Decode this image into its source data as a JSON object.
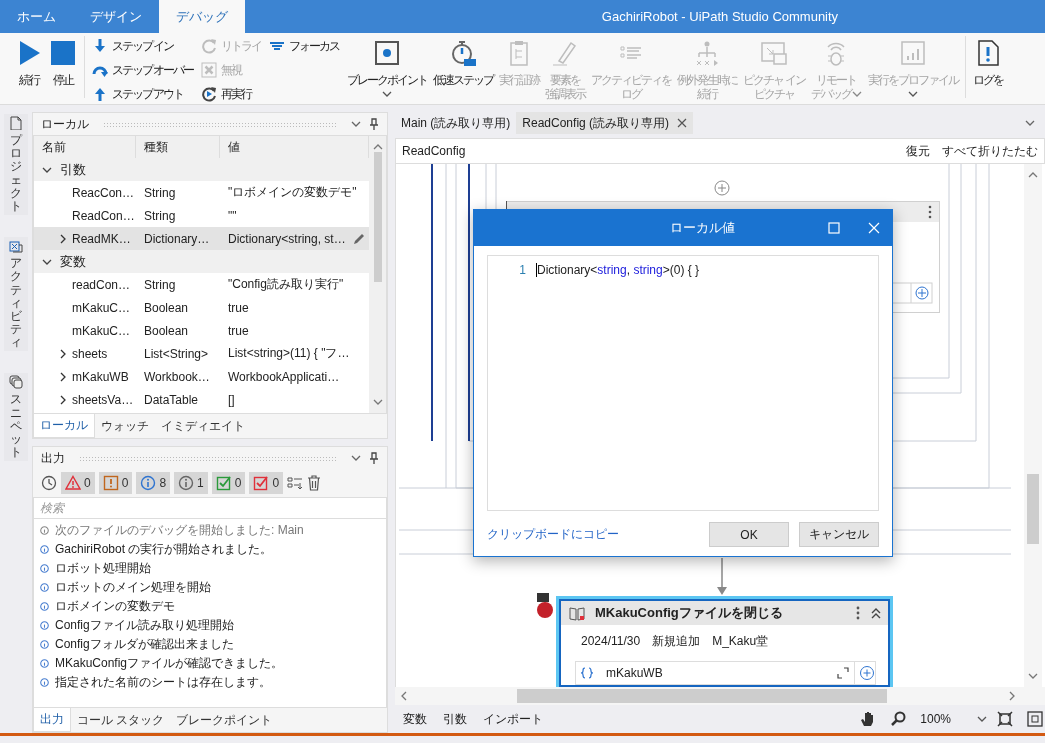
{
  "title_bar": {
    "tabs": [
      {
        "label": "ホーム",
        "selected": false
      },
      {
        "label": "デザイン",
        "selected": false
      },
      {
        "label": "デバッグ",
        "selected": true
      }
    ],
    "title": "GachiriRobot - UiPath Studio Community"
  },
  "ribbon": {
    "sections": [
      {
        "buttons": [
          {
            "kind": "large",
            "lines": [
              "続行"
            ],
            "disabled": false
          },
          {
            "kind": "large",
            "lines": [
              "停止"
            ],
            "disabled": false
          }
        ]
      },
      {
        "buttons": [
          {
            "kind": "small",
            "label": "ステップ イン",
            "disabled": false
          },
          {
            "kind": "small",
            "label": "ステップ オーバー",
            "disabled": false
          },
          {
            "kind": "small",
            "label": "ステップ アウト",
            "disabled": false
          },
          {
            "kind": "small",
            "label": "リトライ",
            "disabled": true
          },
          {
            "kind": "small",
            "label": "無視",
            "disabled": true
          },
          {
            "kind": "small",
            "label": "再実行",
            "disabled": false
          },
          {
            "kind": "small",
            "label": "フォーカス",
            "disabled": false
          },
          {
            "kind": "large",
            "lines": [
              "ブレークポイント"
            ],
            "disabled": false,
            "dropdown": true
          },
          {
            "kind": "large",
            "lines": [
              "低速ステップ"
            ],
            "disabled": false
          },
          {
            "kind": "large",
            "lines": [
              "実行証跡"
            ],
            "disabled": true
          },
          {
            "kind": "large",
            "lines": [
              "要素を",
              "強調表示"
            ],
            "disabled": true
          },
          {
            "kind": "large",
            "lines": [
              "アクティビティを",
              "ログ"
            ],
            "disabled": true
          },
          {
            "kind": "large",
            "lines": [
              "例外発生時に",
              "続行"
            ],
            "disabled": true
          },
          {
            "kind": "large",
            "lines": [
              "ピクチャ イン",
              "ピクチャ"
            ],
            "disabled": true
          },
          {
            "kind": "large",
            "lines": [
              "リモート",
              "デバッグ"
            ],
            "disabled": true,
            "dropdown": true
          },
          {
            "kind": "large",
            "lines": [
              "実行をプロファイル"
            ],
            "disabled": true,
            "dropdown": true
          }
        ]
      },
      {
        "buttons": [
          {
            "kind": "large",
            "lines": [
              "ログを"
            ],
            "disabled": false
          }
        ]
      }
    ]
  },
  "side_tabs": [
    {
      "label": "プロジェクト",
      "selected": false
    },
    {
      "label": "アクティビティ",
      "selected": false
    },
    {
      "label": "スニペット",
      "selected": false
    }
  ],
  "locals": {
    "title": "ローカル",
    "columns": [
      "名前",
      "種類",
      "値"
    ],
    "groups": [
      {
        "label": "引数",
        "expanded": true,
        "rows": [
          {
            "name": "ReacCon…",
            "type": "String",
            "value": "\"ロボメインの変数デモ\"",
            "expandable": false,
            "selected": false
          },
          {
            "name": "ReadCon…",
            "type": "String",
            "value": "\"\"",
            "expandable": false,
            "selected": false
          },
          {
            "name": "ReadMK…",
            "type": "Dictionary…",
            "value": "Dictionary<string, st…",
            "expandable": true,
            "selected": true
          }
        ]
      },
      {
        "label": "変数",
        "expanded": true,
        "rows": [
          {
            "name": "readCon…",
            "type": "String",
            "value": "\"Config読み取り実行\"",
            "expandable": false,
            "selected": false
          },
          {
            "name": "mKakuC…",
            "type": "Boolean",
            "value": "true",
            "expandable": false,
            "selected": false
          },
          {
            "name": "mKakuC…",
            "type": "Boolean",
            "value": "true",
            "expandable": false,
            "selected": false
          },
          {
            "name": "sheets",
            "type": "List<String>",
            "value": "List<string>(11) { \"フ…",
            "expandable": true,
            "selected": false
          },
          {
            "name": "mKakuWB",
            "type": "Workbook…",
            "value": "WorkbookApplicati…",
            "expandable": true,
            "selected": false
          },
          {
            "name": "sheetsVa…",
            "type": "DataTable",
            "value": "[]",
            "expandable": true,
            "selected": false
          }
        ]
      }
    ],
    "tabs": [
      {
        "label": "ローカル",
        "selected": true
      },
      {
        "label": "ウォッチ",
        "selected": false
      },
      {
        "label": "イミディエイト",
        "selected": false
      }
    ]
  },
  "output": {
    "title": "出力",
    "filters": [
      {
        "count": "0",
        "on": true
      },
      {
        "count": "0",
        "on": true
      },
      {
        "count": "8",
        "on": true
      },
      {
        "count": "1",
        "on": true
      },
      {
        "count": "0",
        "on": true
      },
      {
        "count": "0",
        "on": true
      }
    ],
    "search_placeholder": "検索",
    "lines": [
      {
        "kind": "trace",
        "text": "次のファイルのデバッグを開始しました: Main"
      },
      {
        "kind": "info",
        "text": "GachiriRobot の実行が開始されました。"
      },
      {
        "kind": "info",
        "text": "ロボット処理開始"
      },
      {
        "kind": "info",
        "text": "ロボットのメイン処理を開始"
      },
      {
        "kind": "info",
        "text": "ロボメインの変数デモ"
      },
      {
        "kind": "info",
        "text": "Configファイル読み取り処理開始"
      },
      {
        "kind": "info",
        "text": "Configフォルダが確認出来ました"
      },
      {
        "kind": "info",
        "text": "MKakuConfigファイルが確認できました。"
      },
      {
        "kind": "info",
        "text": "指定された名前のシートは存在します。"
      }
    ],
    "tabs": [
      {
        "label": "出力",
        "selected": true
      },
      {
        "label": "コール スタック",
        "selected": false
      },
      {
        "label": "ブレークポイント",
        "selected": false
      }
    ]
  },
  "designer": {
    "tabs": [
      {
        "label": "Main (読み取り専用)",
        "selected": false,
        "closable": false
      },
      {
        "label": "ReadConfig (読み取り専用)",
        "selected": true,
        "closable": true
      }
    ],
    "breadcrumb": "ReadConfig",
    "actions": [
      "復元",
      "すべて折りたたむ"
    ],
    "activity": {
      "title": "MKakuConfigファイルを閉じる",
      "annotation": "2024/11/30　新規追加　M_Kaku堂",
      "field_value": "mKakuWB",
      "selected": true,
      "breakpoint": true
    },
    "bottom_tabs": [
      "変数",
      "引数",
      "インポート"
    ],
    "zoom": "100%"
  },
  "dialog": {
    "title": "ローカル値",
    "lines": [
      {
        "number": "1",
        "tokens": [
          {
            "kind": "plain",
            "text": "Dictionary<"
          },
          {
            "kind": "keyword",
            "text": "string"
          },
          {
            "kind": "plain",
            "text": ", "
          },
          {
            "kind": "keyword",
            "text": "string"
          },
          {
            "kind": "plain",
            "text": ">(0) { }"
          }
        ]
      }
    ],
    "copy_link": "クリップボードにコピー",
    "buttons": [
      "OK",
      "キャンセル"
    ]
  }
}
